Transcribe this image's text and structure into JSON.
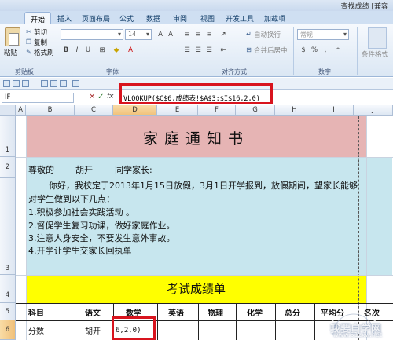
{
  "window": {
    "title": "查找成绩 [兼容"
  },
  "tabs": [
    {
      "label": "开始",
      "active": true
    },
    {
      "label": "插入"
    },
    {
      "label": "页面布局"
    },
    {
      "label": "公式"
    },
    {
      "label": "数据"
    },
    {
      "label": "审阅"
    },
    {
      "label": "视图"
    },
    {
      "label": "开发工具"
    },
    {
      "label": "加载项"
    }
  ],
  "ribbon": {
    "clipboard": {
      "paste": "粘贴",
      "cut": "剪切",
      "copy": "复制",
      "format_painter": "格式刷",
      "group": "剪贴板"
    },
    "font": {
      "size": "14",
      "bold": "B",
      "italic": "I",
      "underline": "U",
      "group": "字体"
    },
    "alignment": {
      "wrap": "自动换行",
      "merge": "合并后居中",
      "group": "对齐方式"
    },
    "number": {
      "format": "常规",
      "group": "数字"
    },
    "styles": {
      "conditional": "条件格式"
    }
  },
  "formula_bar": {
    "name_box": "IF",
    "cancel": "✕",
    "enter": "✓",
    "fx": "fx",
    "formula": "VLOOKUP($C$6,成绩表!$A$3:$I$16,2,0)"
  },
  "grid": {
    "columns": [
      "A",
      "B",
      "C",
      "D",
      "E",
      "F",
      "G",
      "H",
      "I",
      "J"
    ],
    "selected_column": "D",
    "rows": [
      "1",
      "2",
      "3",
      "4",
      "5",
      "6"
    ],
    "selected_row": "6"
  },
  "notice": {
    "title": "家庭通知书",
    "greeting_prefix": "尊敬的",
    "student_name": "胡开",
    "greeting_suffix": "同学家长:",
    "body_1": "你好，我校定于2013年1月15日放假，3月1日开学报到，放假期间，望家长能够",
    "body_2": "对学生做到以下几点：",
    "points": [
      "1.积极参加社会实践活动 。",
      "2.督促学生复习功课，做好家庭作业。",
      "3.注意人身安全，不要发生意外事故。",
      "4.开学让学生交家长回执单"
    ]
  },
  "scores": {
    "title": "考试成绩单",
    "headers": [
      "科目",
      "语文",
      "数学",
      "英语",
      "物理",
      "化学",
      "总分",
      "平均分",
      "名次"
    ],
    "row_label": "分数",
    "row_name": "胡开",
    "row_formula": "6,2,0)"
  },
  "watermark": {
    "brand": "我要自学网",
    "url": "www.51zxw.net"
  },
  "colors": {
    "banner": "#e6b4b4",
    "letter": "#c7e6ee",
    "score_title": "#ffff00",
    "highlight": "#d8141e"
  }
}
